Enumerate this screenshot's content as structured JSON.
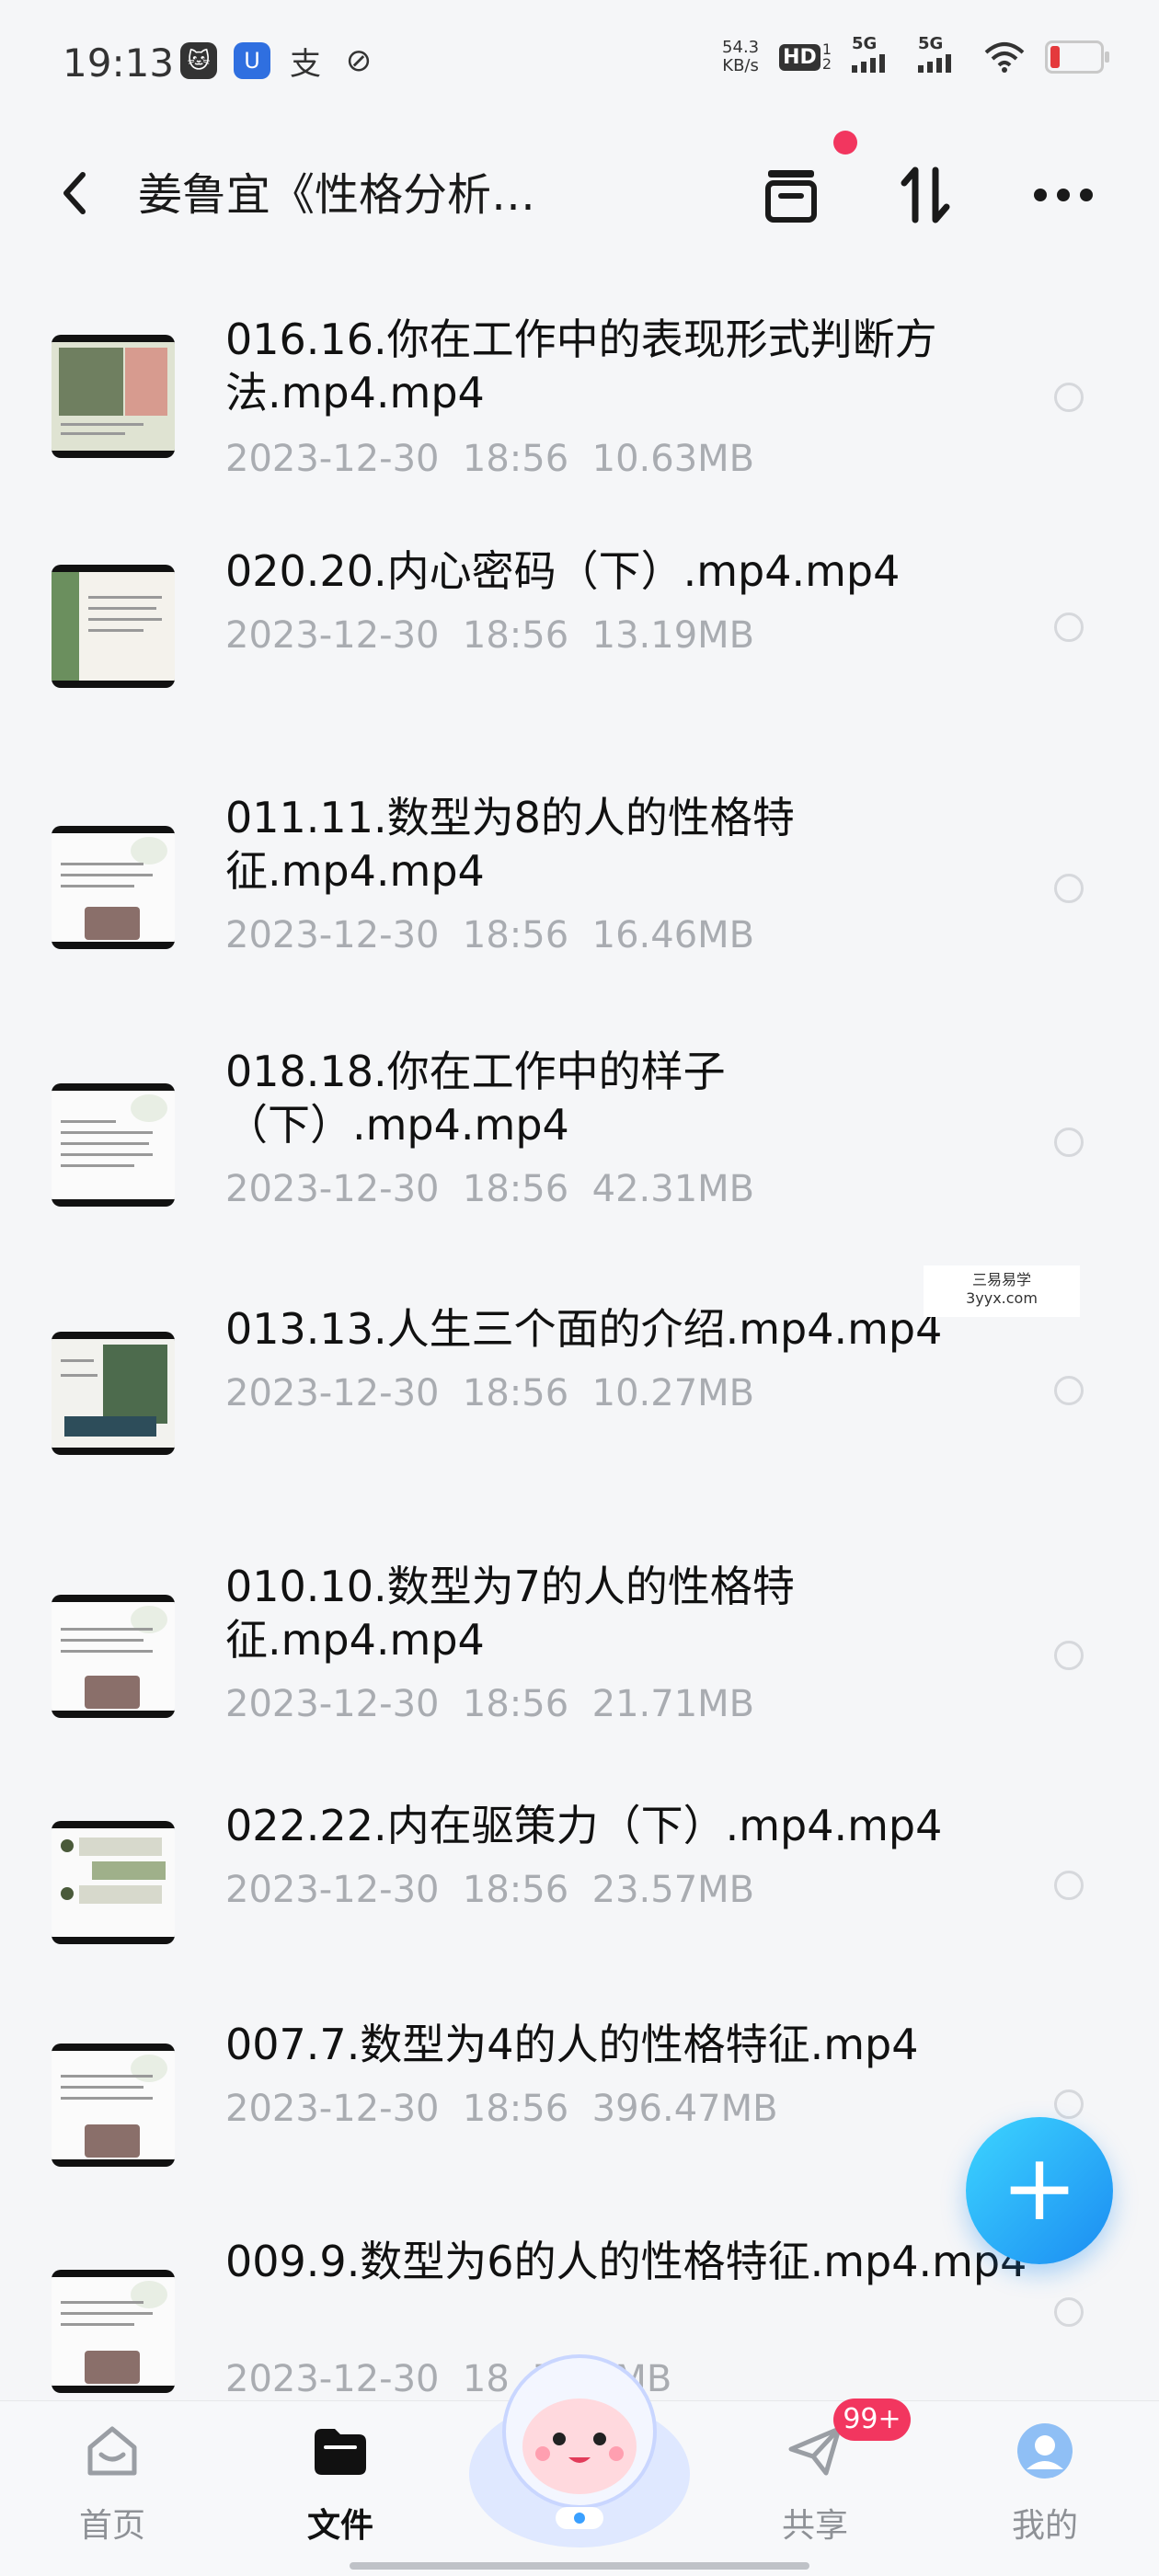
{
  "status": {
    "time": "19:13",
    "app_icons": [
      "cat-icon",
      "u-shield-icon",
      "alipay-icon",
      "leaf-icon"
    ],
    "app_icon_glyphs": [
      "🐱",
      "U",
      "支",
      "⊘"
    ],
    "speed_value": "54.3",
    "speed_unit": "KB/s",
    "hd_label": "HD",
    "hd_sub_1": "1",
    "hd_sub_2": "2",
    "sim1": "5G",
    "sim2": "5G",
    "battery_color": "#e4393c"
  },
  "header": {
    "back_glyph": "‹",
    "title": "姜鲁宜《性格分析…"
  },
  "files": [
    {
      "name": "016.16.你在工作中的表现形式判断方法.mp4.mp4",
      "date": "2023-12-30",
      "time": "18:56",
      "size": "10.63MB"
    },
    {
      "name": "020.20.内心密码（下）.mp4.mp4",
      "date": "2023-12-30",
      "time": "18:56",
      "size": "13.19MB"
    },
    {
      "name": "011.11.数型为8的人的性格特征.mp4.mp4",
      "date": "2023-12-30",
      "time": "18:56",
      "size": "16.46MB"
    },
    {
      "name": "018.18.你在工作中的样子（下）.mp4.mp4",
      "date": "2023-12-30",
      "time": "18:56",
      "size": "42.31MB"
    },
    {
      "name": "013.13.人生三个面的介绍.mp4.mp4",
      "date": "2023-12-30",
      "time": "18:56",
      "size": "10.27MB"
    },
    {
      "name": "010.10.数型为7的人的性格特征.mp4.mp4",
      "date": "2023-12-30",
      "time": "18:56",
      "size": "21.71MB"
    },
    {
      "name": "022.22.内在驱策力（下）.mp4.mp4",
      "date": "2023-12-30",
      "time": "18:56",
      "size": "23.57MB"
    },
    {
      "name": "007.7.数型为4的人的性格特征.mp4",
      "date": "2023-12-30",
      "time": "18:56",
      "size": "396.47MB"
    },
    {
      "name": "009.9.数型为6的人的性格特征.mp4.mp4",
      "date": "2023-12-30",
      "time": "18",
      "size": "7.21MB"
    }
  ],
  "watermark": {
    "line1": "三易易学",
    "line2": "3yyx.com"
  },
  "fab": {
    "glyph": "+"
  },
  "nav": {
    "items": [
      {
        "label": "首页",
        "icon": "home-icon"
      },
      {
        "label": "文件",
        "icon": "folder-icon"
      },
      {
        "label": "共享",
        "icon": "paper-plane-icon"
      },
      {
        "label": "我的",
        "icon": "profile-icon"
      }
    ],
    "share_badge": "99+"
  }
}
